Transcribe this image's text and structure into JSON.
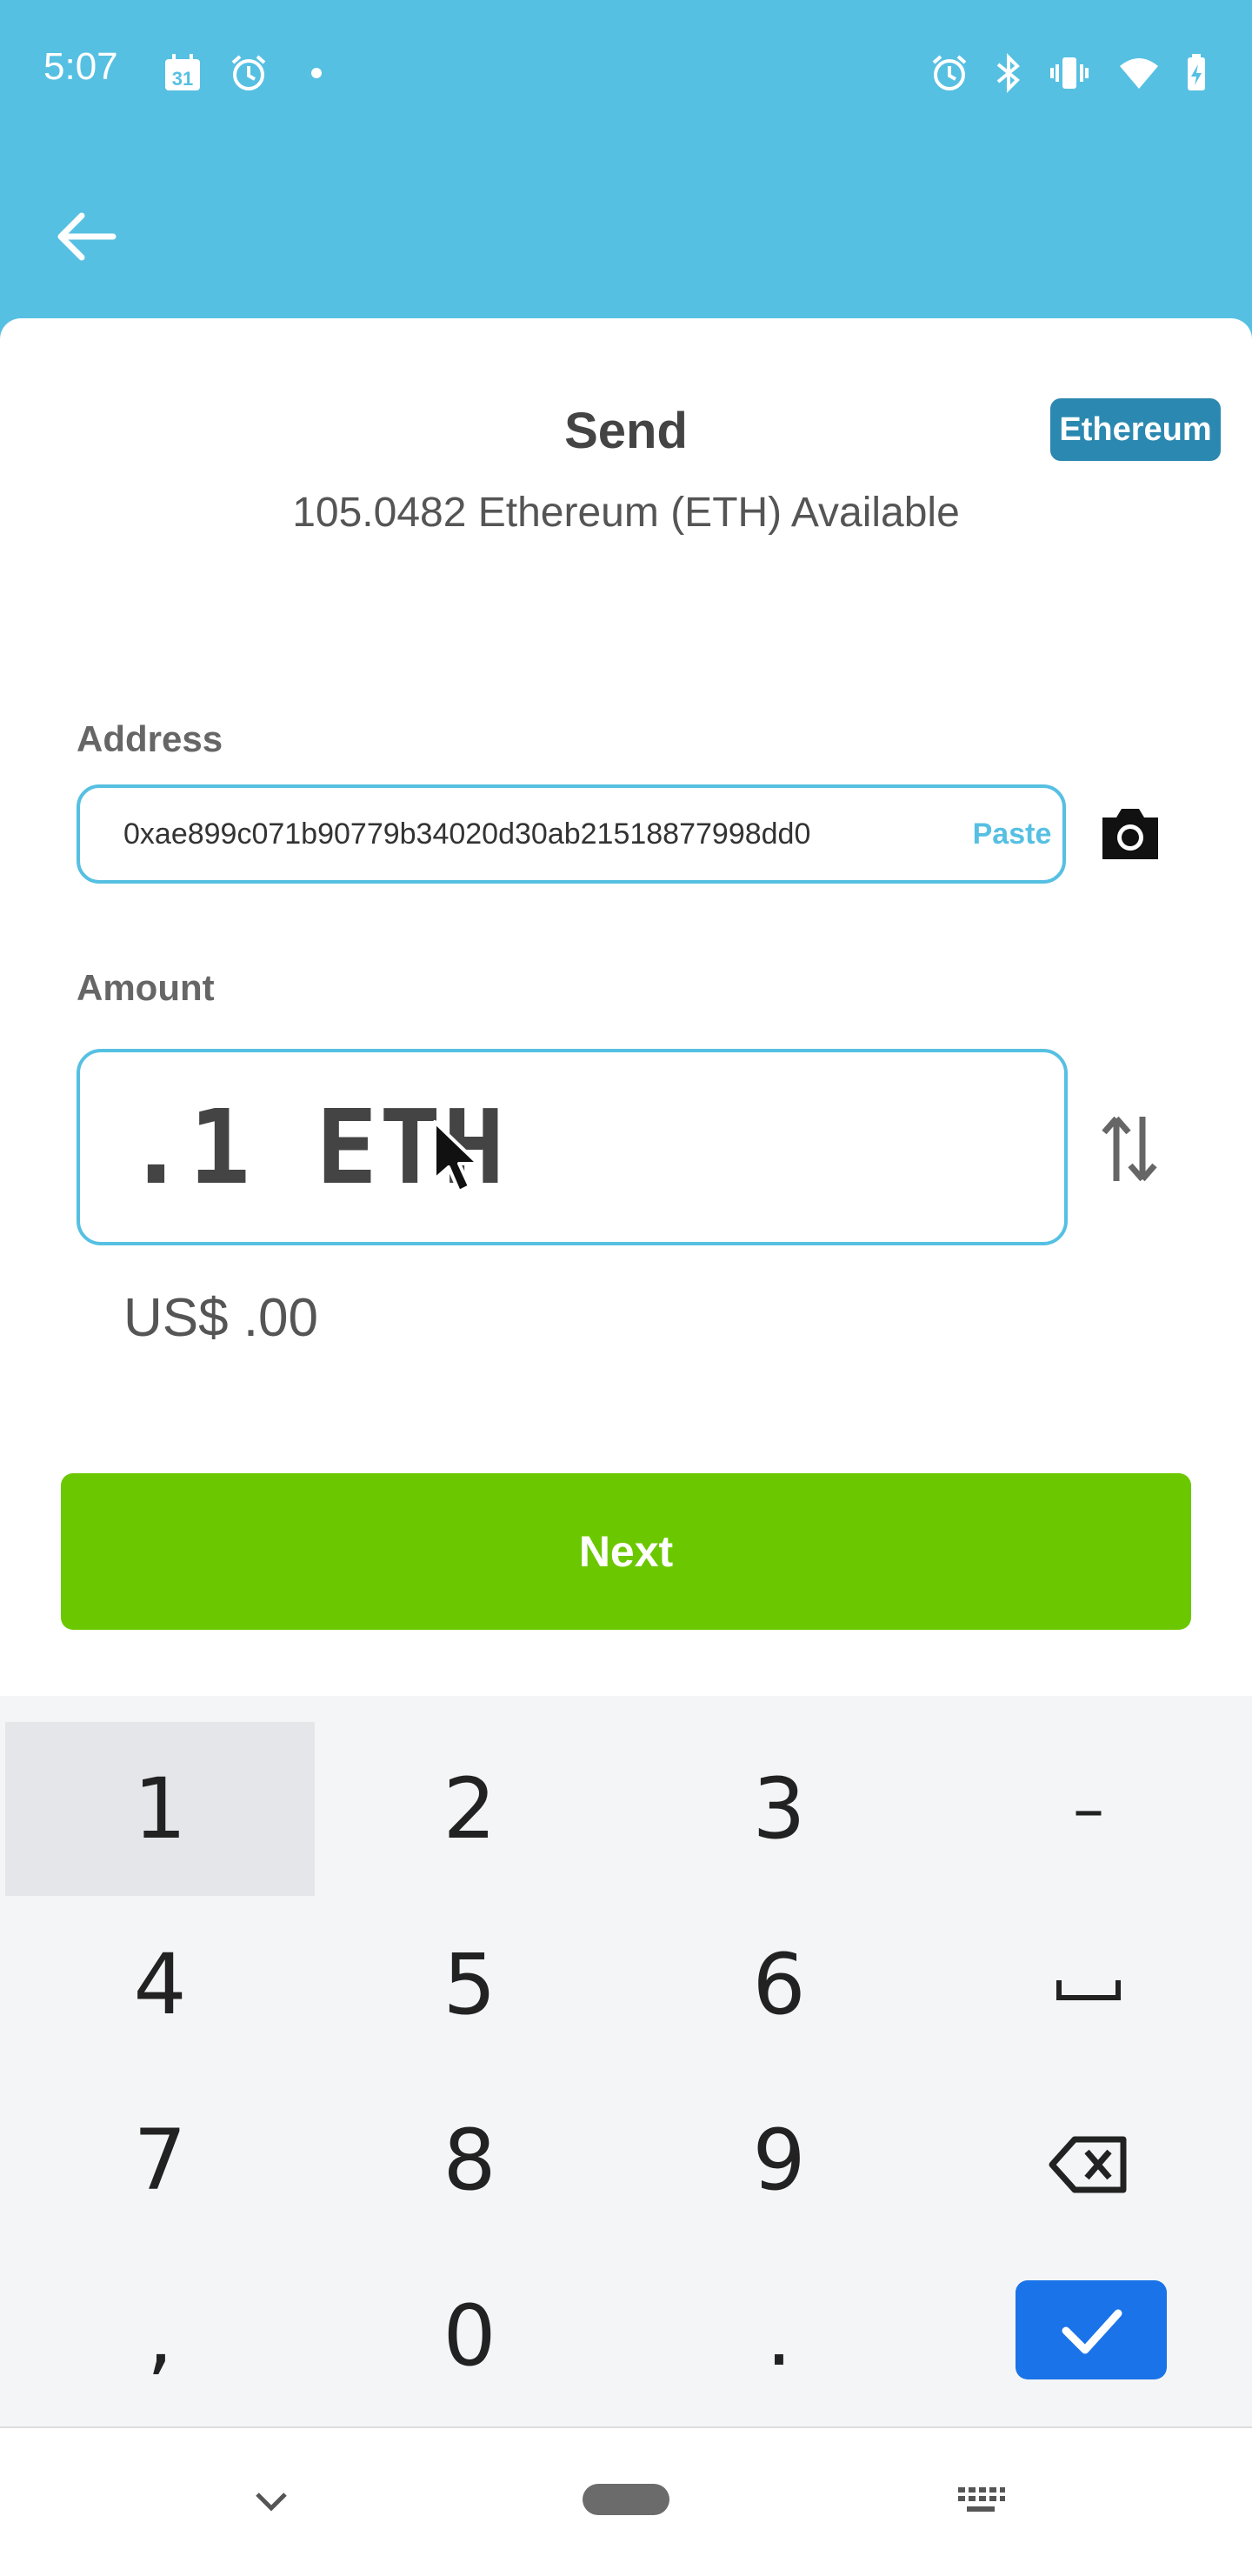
{
  "status_bar": {
    "time": "5:07",
    "left_icons": [
      "calendar-icon",
      "alarm-icon",
      "dot-icon"
    ],
    "right_icons": [
      "alarm-icon",
      "bluetooth-icon",
      "vibrate-icon",
      "wifi-icon",
      "battery-icon"
    ],
    "calendar_day": "31"
  },
  "header": {
    "back_icon": "arrow-left-icon",
    "background": "#56C0E2"
  },
  "send": {
    "title": "Send",
    "network_badge": "Ethereum",
    "available": "105.0482  Ethereum (ETH)  Available"
  },
  "address": {
    "label": "Address",
    "value": "0xae899c071b90779b34020d30ab21518877998dd0",
    "paste_label": "Paste",
    "camera_icon": "camera-icon"
  },
  "amount": {
    "label": "Amount",
    "value": ".1 ETH",
    "swap_icon": "swap-vertical-icon",
    "fiat": "US$ .00"
  },
  "next_label": "Next",
  "keypad": {
    "rows": [
      [
        "1",
        "2",
        "3",
        "–"
      ],
      [
        "4",
        "5",
        "6",
        "␣"
      ],
      [
        "7",
        "8",
        "9",
        "⌫"
      ],
      [
        ",",
        "0",
        ".",
        "✓"
      ]
    ],
    "pressed_key": "1",
    "done_color": "#1A73E8"
  },
  "colors": {
    "accent": "#56C0E2",
    "next": "#6BC800",
    "badge": "#2B88B0"
  },
  "nav_bar": {
    "icons": [
      "chevron-down-icon",
      "home-pill-icon",
      "keyboard-icon"
    ]
  }
}
